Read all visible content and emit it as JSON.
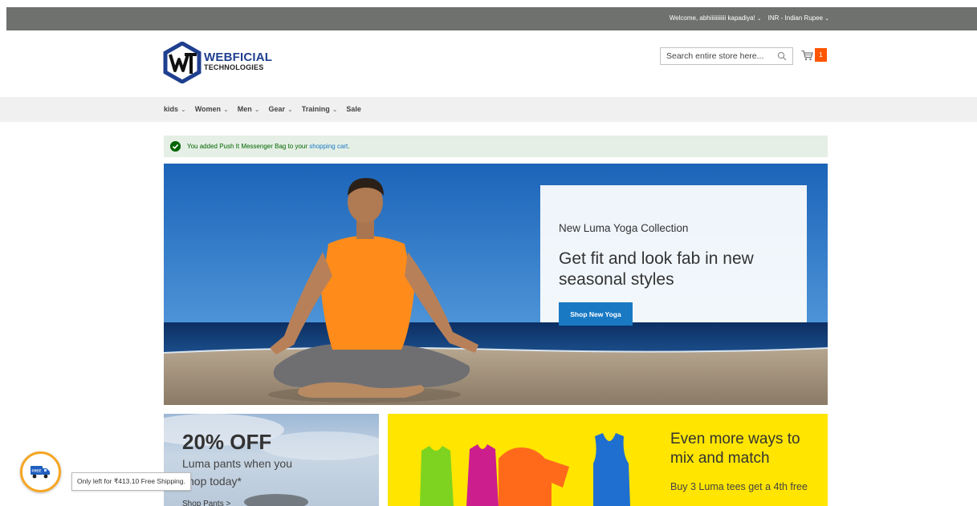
{
  "topbar": {
    "welcome": "Welcome, abhiiiiiiiiiii kapadiya!",
    "currency": "INR - Indian Rupee"
  },
  "header": {
    "logo_line1": "WEBFICIAL",
    "logo_line2": "TECHNOLOGIES",
    "search_placeholder": "Search entire store here...",
    "cart_count": "1"
  },
  "nav": {
    "items": [
      {
        "label": "kids",
        "has_dropdown": true
      },
      {
        "label": "Women",
        "has_dropdown": true
      },
      {
        "label": "Men",
        "has_dropdown": true
      },
      {
        "label": "Gear",
        "has_dropdown": true
      },
      {
        "label": "Training",
        "has_dropdown": true
      },
      {
        "label": "Sale",
        "has_dropdown": false
      }
    ]
  },
  "message": {
    "prefix": "You added Push It Messenger Bag to your ",
    "link": "shopping cart",
    "suffix": "."
  },
  "hero": {
    "subtitle": "New Luma Yoga Collection",
    "title": "Get fit and look fab in new seasonal styles",
    "button": "Shop New Yoga"
  },
  "promo_left": {
    "headline": "20% OFF",
    "line1": "Luma pants when you",
    "line2": "shop today*",
    "link": "Shop Pants >"
  },
  "promo_right": {
    "headline": "Even more ways to mix and match",
    "body": "Buy 3 Luma tees get a 4th free"
  },
  "shipping": {
    "badge": "FREE",
    "tooltip": "Only left for ₹413.10 Free Shipping."
  },
  "colors": {
    "topbar": "#6e716e",
    "accent_blue": "#1979c3",
    "cart_badge": "#ff5501",
    "success_bg": "#e5efe5",
    "success_text": "#006400",
    "promo_yellow": "#ffe500",
    "shipping_ring": "#f5a623"
  }
}
